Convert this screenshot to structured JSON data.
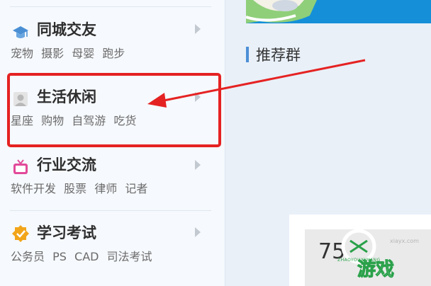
{
  "section": {
    "title": "推荐群"
  },
  "categories": [
    {
      "title": "同城交友",
      "icon": "graduation-cap-icon",
      "subs": [
        "宠物",
        "摄影",
        "母婴",
        "跑步"
      ]
    },
    {
      "title": "生活休闲",
      "icon": "person-avatar-icon",
      "subs": [
        "星座",
        "购物",
        "自驾游",
        "吃货"
      ]
    },
    {
      "title": "行业交流",
      "icon": "tv-icon",
      "subs": [
        "软件开发",
        "股票",
        "律师",
        "记者"
      ]
    },
    {
      "title": "学习考试",
      "icon": "badge-check-icon",
      "subs": [
        "公务员",
        "PS",
        "CAD",
        "司法考试"
      ]
    }
  ],
  "card": {
    "number": "75"
  },
  "watermark": {
    "main": "游戏",
    "small": "ZHAOYOUXIWANG",
    "url": "xiayx.com"
  },
  "colors": {
    "highlight": "#e52222",
    "accent": "#1590d8",
    "title_bar": "#4d8fd6"
  }
}
